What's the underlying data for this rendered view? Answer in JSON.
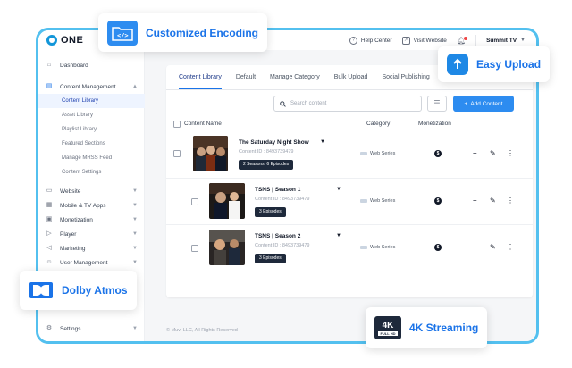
{
  "brand": {
    "name": "ONE"
  },
  "topbar": {
    "help": "Help Center",
    "visit": "Visit Website",
    "account": "Summit TV"
  },
  "sidebar": {
    "dashboard": "Dashboard",
    "content_management": "Content Management",
    "sub_items": [
      "Content Library",
      "Asset Library",
      "Playlist Library",
      "Featured Sections",
      "Manage MRSS Feed",
      "Content Settings"
    ],
    "items": [
      "Website",
      "Mobile & TV Apps",
      "Monetization",
      "Player",
      "Marketing",
      "User Management"
    ],
    "settings": "Settings"
  },
  "tabs": [
    "Content Library",
    "Default",
    "Manage Category",
    "Bulk Upload",
    "Social Publishing"
  ],
  "search": {
    "placeholder": "Search content"
  },
  "add_button": "Add Content",
  "table": {
    "headers": {
      "name": "Content Name",
      "category": "Category",
      "monetization": "Monetization"
    },
    "rows": [
      {
        "title": "The Saturday Night Show",
        "id": "Content ID : 8493739479",
        "badge": "2 Seasons, 6 Episodes",
        "category": "Web Series"
      },
      {
        "title": "TSNS | Season 1",
        "id": "Content ID : 8493739479",
        "badge": "3 Episodes",
        "category": "Web Series"
      },
      {
        "title": "TSNS | Season 2",
        "id": "Content ID : 8493739479",
        "badge": "3 Episodes",
        "category": "Web Series"
      }
    ]
  },
  "footer": "© Muvi LLC, All Rights Reserved",
  "callouts": {
    "encoding": "Customized Encoding",
    "upload": "Easy Upload",
    "dolby": "Dolby Atmos",
    "streaming": "4K Streaming",
    "badge_4k": "4K",
    "badge_fullhd": "FULL HD"
  },
  "colors": {
    "accent": "#1a73e8",
    "frame": "#53c0ef",
    "button": "#2d8cf0"
  }
}
